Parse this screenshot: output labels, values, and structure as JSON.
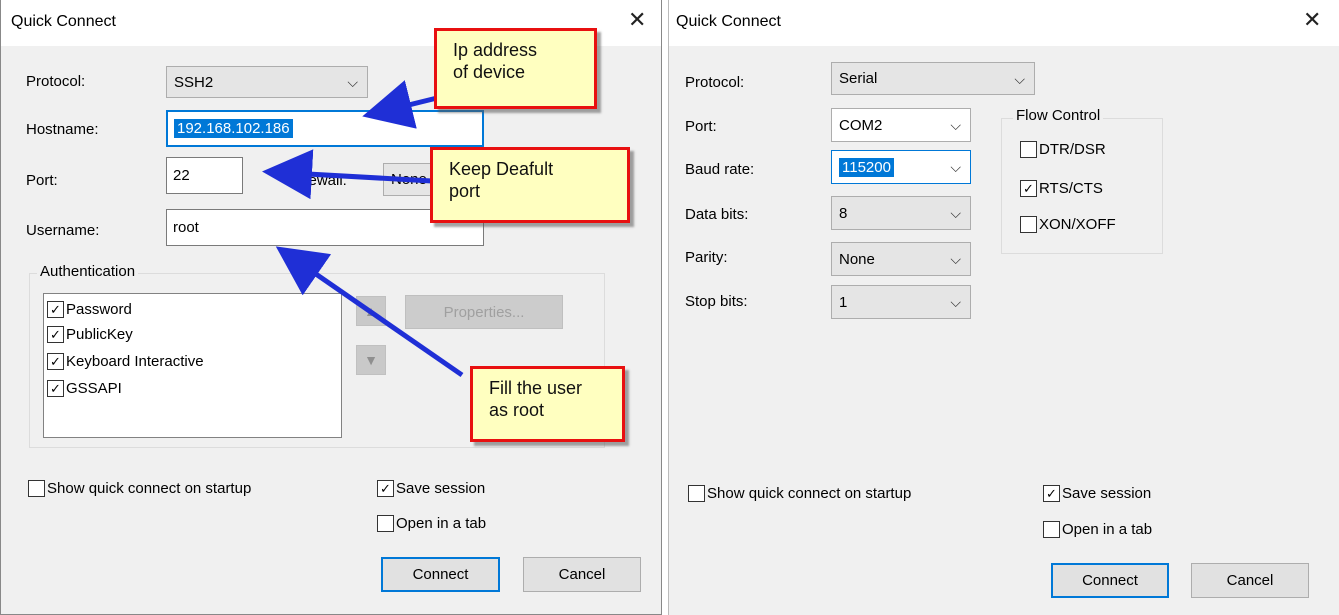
{
  "left_dialog": {
    "title": "Quick Connect",
    "close_glyph": "✕",
    "protocol": {
      "label": "Protocol:",
      "value": "SSH2"
    },
    "hostname": {
      "label": "Hostname:",
      "value": "192.168.102.186"
    },
    "port": {
      "label": "Port:",
      "value": "22"
    },
    "firewall": {
      "label": "Firewall:",
      "value": "None"
    },
    "username": {
      "label": "Username:",
      "value": "root"
    },
    "authentication": {
      "title": "Authentication",
      "items": [
        {
          "label": "Password",
          "checked": true
        },
        {
          "label": "PublicKey",
          "checked": true
        },
        {
          "label": "Keyboard Interactive",
          "checked": true
        },
        {
          "label": "GSSAPI",
          "checked": true
        }
      ],
      "properties_label": "Properties..."
    },
    "show_on_startup": {
      "label": "Show quick connect on startup",
      "checked": false
    },
    "save_session": {
      "label": "Save session",
      "checked": true
    },
    "open_in_tab": {
      "label": "Open in a tab",
      "checked": false
    },
    "connect_label": "Connect",
    "cancel_label": "Cancel"
  },
  "right_dialog": {
    "title": "Quick Connect",
    "close_glyph": "✕",
    "protocol": {
      "label": "Protocol:",
      "value": "Serial"
    },
    "port": {
      "label": "Port:",
      "value": "COM2"
    },
    "baud_rate": {
      "label": "Baud rate:",
      "value": "115200"
    },
    "data_bits": {
      "label": "Data bits:",
      "value": "8"
    },
    "parity": {
      "label": "Parity:",
      "value": "None"
    },
    "stop_bits": {
      "label": "Stop bits:",
      "value": "1"
    },
    "flow_control": {
      "title": "Flow Control",
      "items": [
        {
          "label": "DTR/DSR",
          "checked": false
        },
        {
          "label": "RTS/CTS",
          "checked": true
        },
        {
          "label": "XON/XOFF",
          "checked": false
        }
      ]
    },
    "show_on_startup": {
      "label": "Show quick connect on startup",
      "checked": false
    },
    "save_session": {
      "label": "Save session",
      "checked": true
    },
    "open_in_tab": {
      "label": "Open in a tab",
      "checked": false
    },
    "connect_label": "Connect",
    "cancel_label": "Cancel"
  },
  "annotations": {
    "ip_note": {
      "line1": "Ip address",
      "line2": "of device"
    },
    "port_note": {
      "line1": "Keep Deafult",
      "line2": "port"
    },
    "user_note": {
      "line1": "Fill the user",
      "line2": "as root"
    }
  },
  "glyphs": {
    "check": "✓",
    "chevron": "⌵",
    "up": "▲",
    "down": "▼"
  },
  "colors": {
    "selection": "#0078d7",
    "note_fill": "#ffffc0",
    "note_border": "#e81010",
    "arrow": "#1f2fd6",
    "dialog_bg": "#f0f0f0"
  }
}
